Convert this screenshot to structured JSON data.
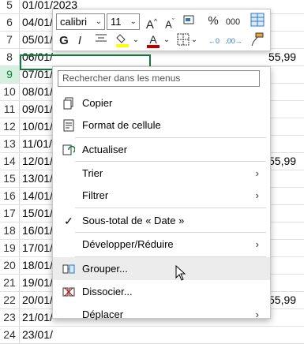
{
  "sheet": {
    "rows": [
      {
        "num": "5",
        "date": "01/01/2023",
        "c": "",
        "d": ""
      },
      {
        "num": "6",
        "date": "04/01/",
        "c": "",
        "d": ""
      },
      {
        "num": "7",
        "date": "05/01/",
        "c": "",
        "d": ""
      },
      {
        "num": "8",
        "date": "06/01/",
        "c": "",
        "d": "55,99"
      },
      {
        "num": "9",
        "date": "07/01/2023",
        "c": "55,99",
        "d": ""
      },
      {
        "num": "10",
        "date": "08/01/",
        "c": "",
        "d": ""
      },
      {
        "num": "11",
        "date": "09/01/",
        "c": "",
        "d": ""
      },
      {
        "num": "12",
        "date": "10/01/",
        "c": "",
        "d": ""
      },
      {
        "num": "13",
        "date": "11/01/",
        "c": "",
        "d": ""
      },
      {
        "num": "14",
        "date": "12/01/",
        "c": "",
        "d": "55,99"
      },
      {
        "num": "15",
        "date": "13/01/",
        "c": "",
        "d": ""
      },
      {
        "num": "16",
        "date": "14/01/",
        "c": "",
        "d": ""
      },
      {
        "num": "17",
        "date": "15/01/",
        "c": "",
        "d": ""
      },
      {
        "num": "18",
        "date": "16/01/",
        "c": "",
        "d": ""
      },
      {
        "num": "19",
        "date": "17/01/",
        "c": "",
        "d": ""
      },
      {
        "num": "20",
        "date": "18/01/",
        "c": "",
        "d": ""
      },
      {
        "num": "21",
        "date": "19/01/",
        "c": "",
        "d": ""
      },
      {
        "num": "22",
        "date": "20/01/",
        "c": "",
        "d": "55,99"
      },
      {
        "num": "23",
        "date": "21/01/",
        "c": "",
        "d": ""
      },
      {
        "num": "24",
        "date": "23/01/",
        "c": "",
        "d": ""
      }
    ]
  },
  "minitoolbar": {
    "font": "calibri",
    "size": "11",
    "increase_font": "A^",
    "decrease_font": "Aˇ",
    "percent": "%",
    "thousands": "000",
    "bold": "G",
    "italic": "I",
    "fill_letter": "A"
  },
  "menu": {
    "search_placeholder": "Rechercher dans les menus",
    "items": [
      {
        "label": "Copier"
      },
      {
        "label": "Format de cellule"
      },
      {
        "label": "Actualiser"
      },
      {
        "label": "Trier"
      },
      {
        "label": "Filtrer"
      },
      {
        "label": "Sous-total de « Date »"
      },
      {
        "label": "Développer/Réduire"
      },
      {
        "label": "Grouper..."
      },
      {
        "label": "Dissocier..."
      },
      {
        "label": "Déplacer"
      }
    ]
  },
  "colors": {
    "accent": "#107c41",
    "fill_yellow": "#ffff00",
    "font_red": "#c00000"
  }
}
